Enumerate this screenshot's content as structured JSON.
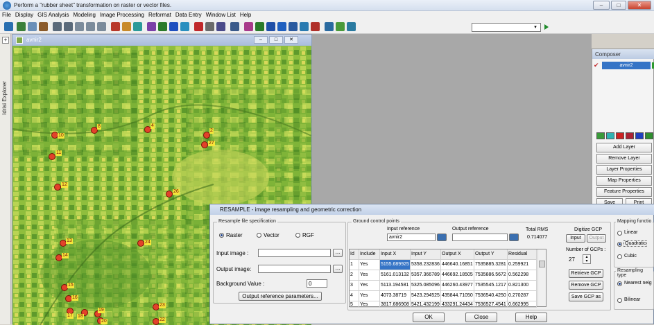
{
  "window": {
    "title": "Perform a \"rubber sheet\" transformation on raster or vector files.",
    "min": "‒",
    "restore": "□",
    "close": "✕"
  },
  "menu": [
    "File",
    "Display",
    "GIS Analysis",
    "Modeling",
    "Image Processing",
    "Reformat",
    "Data Entry",
    "Window List",
    "Help"
  ],
  "toolbar": {
    "combo_value": ""
  },
  "explorer": {
    "label": "Idrisi Explorer"
  },
  "map": {
    "title": "avnir2",
    "gcps": [
      {
        "label": "8"
      },
      {
        "label": "4"
      },
      {
        "label": "2"
      },
      {
        "label": "10"
      },
      {
        "label": "11"
      },
      {
        "label": "27"
      },
      {
        "label": "12"
      },
      {
        "label": "26"
      },
      {
        "label": "13"
      },
      {
        "label": "24"
      },
      {
        "label": "14"
      },
      {
        "label": "15"
      },
      {
        "label": "16"
      },
      {
        "label": "17"
      },
      {
        "label": "18"
      },
      {
        "label": "19"
      },
      {
        "label": "20"
      },
      {
        "label": "23"
      },
      {
        "label": "22"
      }
    ]
  },
  "composer": {
    "title": "Composer",
    "layer": "avnir2",
    "layer_colors": [
      "#3a9a3a",
      "#2fb3b3",
      "#cc2222",
      "#aa2233",
      "#1f3fbf",
      "#2f8f2f"
    ],
    "buttons": [
      "Add Layer",
      "Remove Layer",
      "Layer Properties",
      "Map Properties",
      "Feature Properties"
    ],
    "save": "Save",
    "print": "Print"
  },
  "dialog": {
    "title": "RESAMPLE - image resampling and geometric correction",
    "resample_group": "Resample file specification",
    "file_types": [
      "Raster",
      "Vector",
      "RGF"
    ],
    "input_image_label": "Input image :",
    "output_image_label": "Output image:",
    "background_label": "Background Value :",
    "background_value": "0",
    "output_ref_btn": "Output reference parameters...",
    "browse": "...",
    "gcp_group": "Ground control points",
    "input_reference_label": "Input reference",
    "input_reference_value": "avnir2",
    "output_reference_label": "Output reference",
    "output_reference_value": "",
    "total_rms_label": "Total RMS",
    "total_rms_value": "0.714077",
    "digitize_label": "Digitize GCP",
    "digitize_input": "Input",
    "digitize_output": "Output",
    "num_gcps_label": "Number of GCPs :",
    "num_gcps_value": "27",
    "retrieve_btn": "Retrieve GCP",
    "remove_btn": "Remove GCP",
    "save_btn": "Save GCP as",
    "table": {
      "headers": [
        "Id",
        "Include",
        "Input X",
        "Input Y",
        "Output X",
        "Output Y",
        "Residual"
      ],
      "rows": [
        [
          "1",
          "Yes",
          "5155.689925",
          "5358.232836",
          "446640.16851",
          "7535885.3281",
          "0.259921"
        ],
        [
          "2",
          "Yes",
          "5161.013132",
          "5357.366789",
          "446692.18505",
          "7535886.5672",
          "0.562298"
        ],
        [
          "3",
          "Yes",
          "5113.194581",
          "5325.085096",
          "446260.43977",
          "7535545.1217",
          "0.821300"
        ],
        [
          "4",
          "Yes",
          "4073.38719",
          "5423.294525",
          "435844.71050",
          "7536540.4250",
          "0.270287"
        ],
        [
          "5",
          "Yes",
          "3817.686908",
          "5421.432199",
          "433291.24434",
          "7536527.4541",
          "0.662995"
        ]
      ]
    },
    "mapping_label": "Mapping functio",
    "mapping_options": [
      "Linear",
      "Quadratic",
      "Cubic"
    ],
    "resampling_label": "Resampling type",
    "resampling_options": [
      "Nearest neig",
      "Bilinear"
    ],
    "ok": "OK",
    "close": "Close",
    "help": "Help"
  }
}
